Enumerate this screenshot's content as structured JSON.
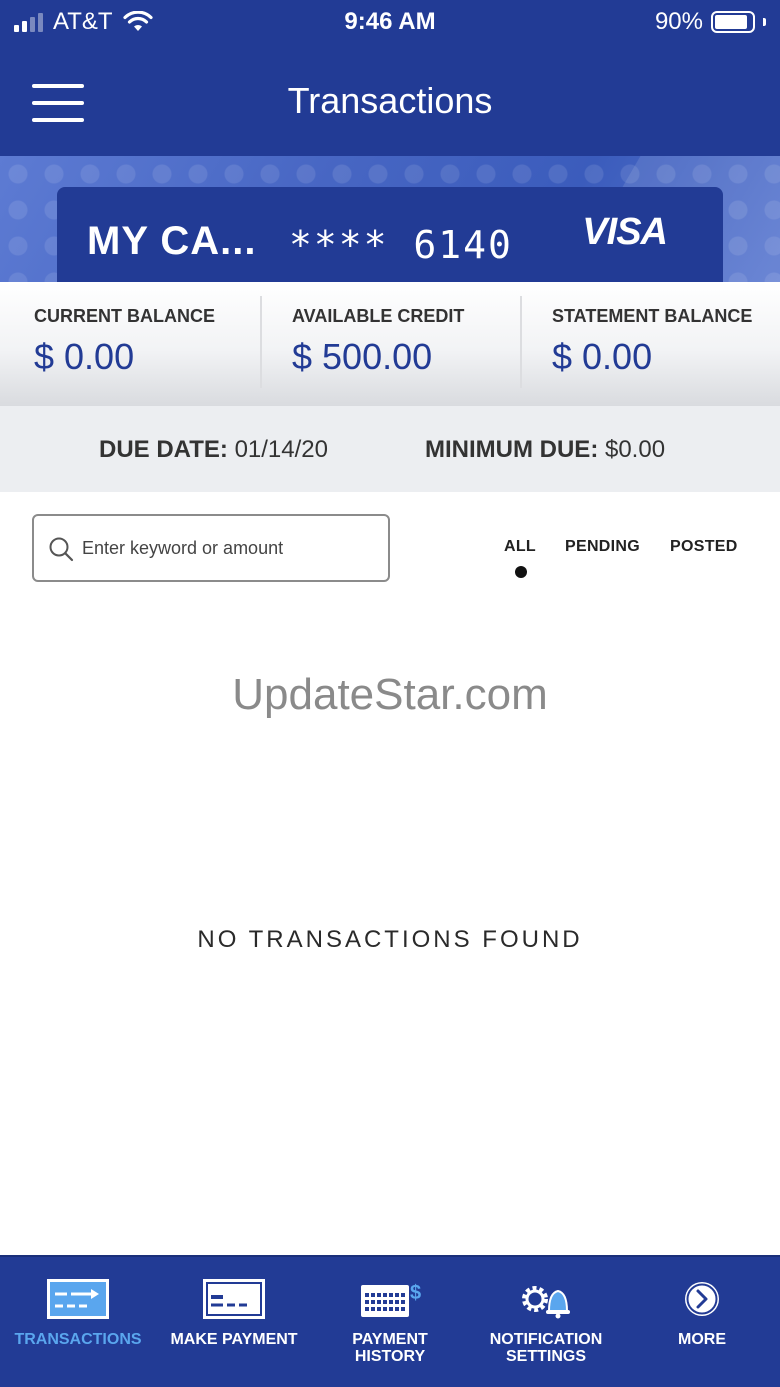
{
  "status_bar": {
    "carrier": "AT&T",
    "time": "9:46 AM",
    "battery": "90%",
    "battery_level": 0.9
  },
  "header": {
    "title": "Transactions"
  },
  "card": {
    "name": "MY CA...",
    "number": "**** 6140",
    "brand": "VISA"
  },
  "balances": [
    {
      "label": "CURRENT BALANCE",
      "value": "$ 0.00"
    },
    {
      "label": "AVAILABLE CREDIT",
      "value": "$ 500.00"
    },
    {
      "label": "STATEMENT BALANCE",
      "value": "$ 0.00"
    }
  ],
  "due": {
    "date_label": "DUE DATE:",
    "date_value": "01/14/20",
    "min_label": "MINIMUM DUE:",
    "min_value": "$0.00"
  },
  "search": {
    "placeholder": "Enter keyword or amount",
    "value": ""
  },
  "filters": [
    {
      "label": "ALL",
      "selected": true
    },
    {
      "label": "PENDING",
      "selected": false
    },
    {
      "label": "POSTED",
      "selected": false
    }
  ],
  "watermark": "UpdateStar.com",
  "empty_message": "NO TRANSACTIONS FOUND",
  "tabs": [
    {
      "label": "TRANSACTIONS",
      "icon": "transactions-icon",
      "active": true
    },
    {
      "label": "MAKE PAYMENT",
      "icon": "make-payment-icon",
      "active": false
    },
    {
      "label_line1": "PAYMENT",
      "label_line2": "HISTORY",
      "icon": "payment-history-icon",
      "active": false
    },
    {
      "label_line1": "NOTIFICATION",
      "label_line2": "SETTINGS",
      "icon": "notification-settings-icon",
      "active": false
    },
    {
      "label": "MORE",
      "icon": "more-icon",
      "active": false
    }
  ],
  "colors": {
    "brand_blue": "#223b95",
    "active_tab": "#5aa6ee"
  }
}
